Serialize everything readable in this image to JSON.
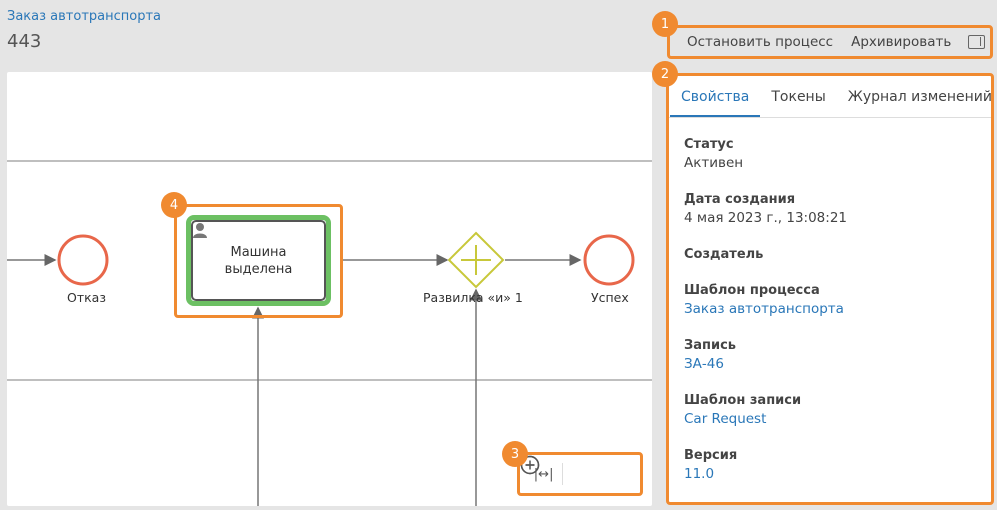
{
  "header": {
    "breadcrumb": "Заказ автотранспорта",
    "title": "443"
  },
  "toolbar": {
    "stop_label": "Остановить процесс",
    "archive_label": "Архивировать"
  },
  "diagram": {
    "task_label": "Машина выделена",
    "reject_label": "Отказ",
    "gateway_label": "Развилка «и» 1",
    "success_label": "Успех"
  },
  "zoom": {
    "fit_glyph": "|↔|",
    "out_glyph": "−",
    "in_glyph": "+"
  },
  "badges": [
    "1",
    "2",
    "3",
    "4"
  ],
  "panel": {
    "tabs": [
      {
        "label": "Свойства",
        "active": true
      },
      {
        "label": "Токены",
        "active": false
      },
      {
        "label": "Журнал изменений",
        "active": false
      }
    ],
    "properties": [
      {
        "label": "Статус",
        "value": "Активен",
        "link": false
      },
      {
        "label": "Дата создания",
        "value": "4 мая 2023 г., 13:08:21",
        "link": false
      },
      {
        "label": "Создатель",
        "value": "",
        "link": false
      },
      {
        "label": "Шаблон процесса",
        "value": "Заказ автотранспорта",
        "link": true
      },
      {
        "label": "Запись",
        "value": "ЗА-46",
        "link": true
      },
      {
        "label": "Шаблон записи",
        "value": "Car Request",
        "link": true
      },
      {
        "label": "Версия",
        "value": "11.0",
        "link": true
      }
    ]
  },
  "colors": {
    "accent": "#2a77b8",
    "highlight": "#f08a30",
    "end_event": "#e8674a",
    "gateway": "#c8c83a",
    "task_border": "#6cc063"
  },
  "icons": [
    "panel-toggle-icon",
    "user-icon",
    "fit-width-icon",
    "zoom-out-icon",
    "zoom-in-icon",
    "plus-gateway-icon"
  ]
}
